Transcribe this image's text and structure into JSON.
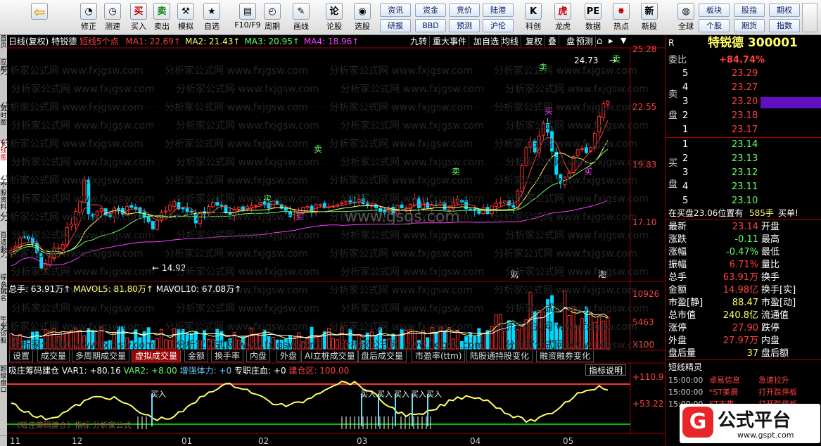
{
  "toolbar": {
    "buttons": [
      {
        "label": "",
        "icon": "back-arrow-icon",
        "glyph": "⇦"
      },
      {
        "label": "修正",
        "icon": "fix-icon",
        "glyph": "◔"
      },
      {
        "label": "测速",
        "icon": "speed-icon",
        "glyph": "◷"
      },
      {
        "label": "买入",
        "icon": "buy-icon",
        "glyph": "买"
      },
      {
        "label": "卖出",
        "icon": "sell-icon",
        "glyph": "卖"
      },
      {
        "label": "模拟",
        "icon": "hammer-icon",
        "glyph": "⚒"
      },
      {
        "label": "自选",
        "icon": "star-icon",
        "glyph": "★"
      },
      {
        "label": "F10/F9",
        "icon": "f10-icon",
        "glyph": "▤"
      },
      {
        "label": "周期",
        "icon": "clock-icon",
        "glyph": "◴"
      },
      {
        "label": "画线",
        "icon": "pencil-icon",
        "glyph": "✎"
      },
      {
        "label": "论股",
        "icon": "discuss-icon",
        "glyph": "论"
      },
      {
        "label": "选股",
        "icon": "pick-icon",
        "glyph": "◉"
      },
      {
        "label": "科创",
        "icon": "kechuang-icon",
        "glyph": "K"
      },
      {
        "label": "龙虎",
        "icon": "dragon-icon",
        "glyph": "虎"
      },
      {
        "label": "数据",
        "icon": "data-icon",
        "glyph": "PE"
      },
      {
        "label": "热点",
        "icon": "hot-icon",
        "glyph": "✸"
      },
      {
        "label": "新股",
        "icon": "newstock-icon",
        "glyph": "新"
      },
      {
        "label": "全球",
        "icon": "globe-icon",
        "glyph": "◍"
      }
    ],
    "small_buttons": [
      "资讯",
      "资金",
      "竞价",
      "陆港",
      "研报",
      "BBD",
      "预测",
      "沪伦",
      "板块",
      "股指",
      "期权",
      "个股",
      "期货",
      "指数"
    ]
  },
  "left_tabs": [
    "首页",
    "应用",
    "分时图",
    "K线图",
    "个股资料",
    "自选股",
    "综合排名",
    "牛叉诊股",
    "超级盘口"
  ],
  "chart": {
    "info_label": "日线(复权)",
    "stock_name": "特锐德",
    "short_line": "短线5个点",
    "ma": [
      {
        "label": "MA1: 22.69↑",
        "color": "#ff4040"
      },
      {
        "label": "MA2: 21.43↑",
        "color": "#ffff66"
      },
      {
        "label": "MA3: 20.95↑",
        "color": "#66ff66"
      },
      {
        "label": "MA4: 18.96↑",
        "color": "#ff40ff"
      }
    ],
    "top_buttons": [
      "九转",
      "重大事件",
      "加自选",
      "均线",
      "复权",
      "叠",
      "盘",
      "预测"
    ],
    "price_ticks": [
      "25.28",
      "22.55",
      "19.83",
      "17.10"
    ],
    "high_label": "24.73",
    "low_label": "14.92",
    "signals": [
      "卖",
      "卖",
      "卖",
      "卖",
      "卖",
      "买",
      "买",
      "买"
    ],
    "events": [
      "财",
      "港"
    ],
    "volume_info": {
      "total": "总手: 63.91万↑",
      "mavol5": "MAVOL5: 81.80万↑",
      "mavol10": "MAVOL10: 67.08万↑"
    },
    "volume_ticks": [
      "10926",
      "5463",
      "X100"
    ],
    "tabs": [
      "设置",
      "成交量",
      "多周期成交量",
      "虚拟成交量",
      "金额",
      "换手率",
      "内盘",
      "外盘",
      "AI立桩成交量",
      "盘后成交量",
      "市盈率(ttm)",
      "陆股通持股变化",
      "融资融券变化"
    ],
    "indicator": {
      "name": "吸庄筹码建仓",
      "var1": "VAR1: +80.16",
      "var2": "VAR2: +8.00",
      "power": "增强体力: +0",
      "special": "专职庄血: +0",
      "build": "建仓区: 100.00",
      "explain": "指标说明",
      "ticks": [
        "+110.9",
        "+53.22"
      ],
      "buy_label": "买入",
      "footer": "《吸庄筹码建仓》指标  分析家公式"
    },
    "months": [
      "11",
      "12",
      "01",
      "02",
      "03",
      "04",
      "05"
    ],
    "watermark": "分析家公式网 www.fxjgsw.com",
    "center_watermark": "www.gsgs.com"
  },
  "right": {
    "code_title": "特锐德  300001",
    "r_label": "R",
    "weibi_label": "委比",
    "weibi_value": "+84.74%",
    "sell_label": "卖盘",
    "buy_label": "买盘",
    "asks": [
      {
        "n": "5",
        "p": "23.29"
      },
      {
        "n": "4",
        "p": "23.27"
      },
      {
        "n": "3",
        "p": "23.20"
      },
      {
        "n": "2",
        "p": "23.18"
      },
      {
        "n": "1",
        "p": "23.17"
      }
    ],
    "bids": [
      {
        "n": "1",
        "p": "23.14"
      },
      {
        "n": "2",
        "p": "23.13"
      },
      {
        "n": "3",
        "p": "23.12"
      },
      {
        "n": "4",
        "p": "23.11"
      },
      {
        "n": "5",
        "p": "23.10"
      }
    ],
    "in_buy": "在买盘23.06位置有",
    "in_buy_qty": "585手",
    "in_buy_tag": "买单!",
    "stats": [
      [
        "最新",
        "23.14",
        "开盘",
        ""
      ],
      [
        "涨跌",
        "-0.11",
        "最高",
        ""
      ],
      [
        "涨幅",
        "-0.47%",
        "最低",
        ""
      ],
      [
        "振幅",
        "6.71%",
        "量比",
        ""
      ],
      [
        "总手",
        "63.91万",
        "换手",
        ""
      ],
      [
        "金额",
        "14.98亿",
        "换手[实]",
        ""
      ],
      [
        "市盈[静]",
        "88.47",
        "市盈[动]",
        ""
      ],
      [
        "总市值",
        "240.8亿",
        "流通值",
        ""
      ],
      [
        "涨停",
        "27.90",
        "跌停",
        ""
      ],
      [
        "外盘",
        "27.97万",
        "内盘",
        ""
      ],
      [
        "盘后量",
        "37",
        "盘后额",
        ""
      ]
    ],
    "elf_title": "短线精灵",
    "elf_rows": [
      [
        "15:00:00",
        "卓易信息",
        "急速拉升"
      ],
      [
        "15:00:00",
        "*ST美晨",
        "打开跌停板"
      ],
      [
        "15:00:00",
        "ST去集",
        "打开跌停板"
      ]
    ],
    "logo_text": "公式平台",
    "logo_url": "www.gspt.com"
  }
}
